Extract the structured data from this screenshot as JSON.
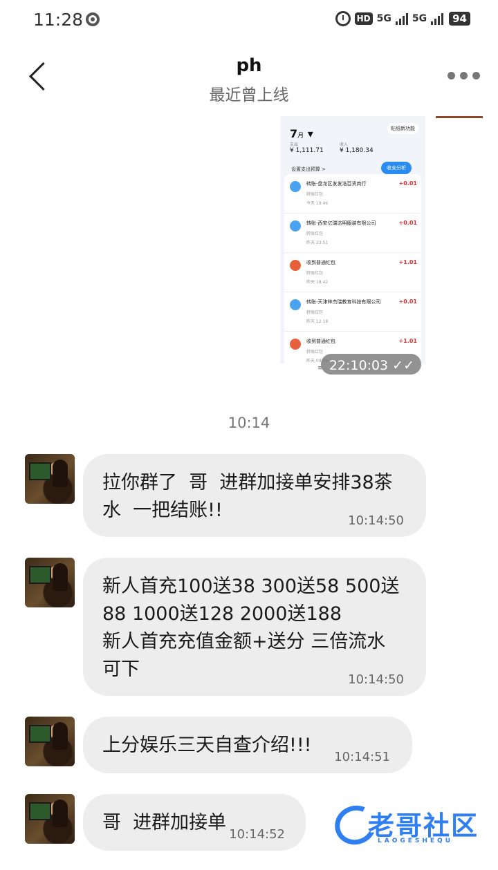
{
  "status_bar": {
    "time": "11:28",
    "hd": "HD",
    "net1": "5G",
    "net2": "5G",
    "battery": "94"
  },
  "header": {
    "name": "ph",
    "status": "最近曾上线"
  },
  "image_message": {
    "month": "7",
    "month_unit": "月",
    "pill": "贴纸新功能",
    "expense_label": "支出",
    "expense": "¥ 1,111.71",
    "income_label": "收入",
    "income": "¥ 1,180.34",
    "budget": "设置支出预算 >",
    "analysis": "收支分析",
    "rows": [
      {
        "title": "转账-盘龙区发发浩百货商行",
        "sub": "转账红包",
        "time": "今天 19:46",
        "value": "+0.01",
        "icon": "transfer"
      },
      {
        "title": "转账-西安亿瑞达明服装有限公司",
        "sub": "转账红包",
        "time": "昨天 23:51",
        "value": "+0.01",
        "icon": "transfer"
      },
      {
        "title": "收到普通红包",
        "sub": "转账红包",
        "time": "昨天 18:42",
        "value": "+1.01",
        "icon": "red-packet"
      },
      {
        "title": "转账-天津梓杰瑞教育科技有限公司",
        "sub": "转账红包",
        "time": "昨天 12:18",
        "value": "+0.01",
        "icon": "transfer"
      },
      {
        "title": "收到普通红包",
        "sub": "转账红包",
        "time": "昨天 09:59",
        "value": "+1.01",
        "icon": "red-packet"
      }
    ],
    "nav": "≡",
    "timestamp": "22:10:03",
    "read_mark": "✓✓"
  },
  "time_divider": "10:14",
  "messages": [
    {
      "text": "拉你群了  哥  进群加接单安排38茶\n水  一把结账!!",
      "time": "10:14:50"
    },
    {
      "text": "新人首充100送38 300送58 500送\n88 1000送128 2000送188\n新人首充充值金额+送分 三倍流水\n可下",
      "time": "10:14:50"
    },
    {
      "text": "上分娱乐三天自查介绍!!!",
      "time": "10:14:51"
    },
    {
      "text": "哥  进群加接单",
      "time": "10:14:52"
    }
  ],
  "watermark": {
    "text": "老哥社区",
    "sub": "LAOGESHEQU"
  },
  "colors": {
    "bubble": "#ededed",
    "accent": "#2a8cf0",
    "income_red": "#e03030"
  }
}
